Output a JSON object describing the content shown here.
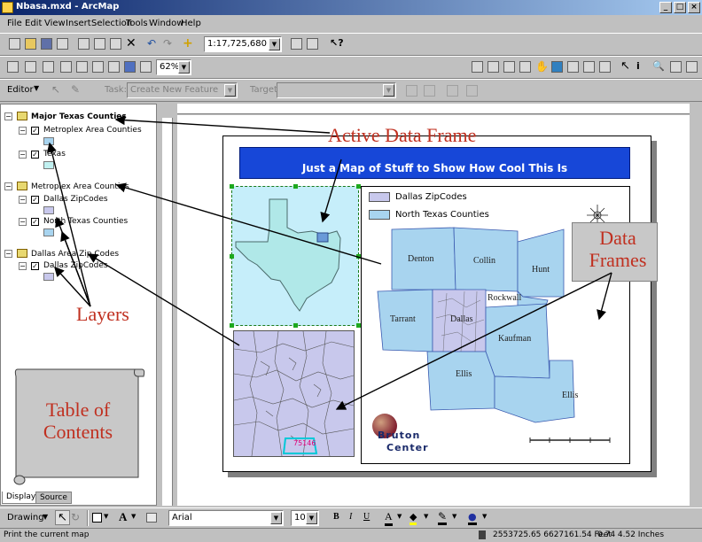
{
  "window": {
    "title": "Nbasa.mxd - ArcMap",
    "minimize": "_",
    "maximize": "□",
    "close": "×"
  },
  "menu": [
    "File",
    "Edit",
    "View",
    "Insert",
    "Selection",
    "Tools",
    "Window",
    "Help"
  ],
  "toolbar": {
    "scale_value": "1:17,725,680",
    "zoom_value": "62%"
  },
  "editor": {
    "editor_label": "Editor",
    "task_label": "Task:",
    "task_value": "Create New Feature",
    "target_label": "Target:",
    "target_value": ""
  },
  "toc": {
    "groups": [
      {
        "name": "Major Texas Counties",
        "layers": [
          {
            "name": "Metroplex Area Counties",
            "color": "#a8d4ef"
          },
          {
            "name": "Texas",
            "color": "#c0f0f0"
          }
        ]
      },
      {
        "name": "Metroplex Area Counties",
        "layers": [
          {
            "name": "Dallas ZipCodes",
            "color": "#c8c8ec"
          },
          {
            "name": "North Texas Counties",
            "color": "#a8d4ef"
          }
        ]
      },
      {
        "name": "Dallas Area Zip Codes",
        "layers": [
          {
            "name": "Dallas ZipCodes",
            "color": "#c8c8ec"
          }
        ]
      }
    ],
    "tabs": [
      "Display",
      "Source"
    ]
  },
  "map": {
    "title": "Just a Map of Stuff to Show How Cool This Is",
    "legend": [
      {
        "label": "Dallas ZipCodes",
        "color": "#c8c8ec"
      },
      {
        "label": "North Texas Counties",
        "color": "#a8d4ef"
      }
    ],
    "counties": [
      "Denton",
      "Collin",
      "Hunt",
      "Rockwall",
      "Tarrant",
      "Dallas",
      "Kaufman",
      "Ellis",
      "Ellis"
    ],
    "zip_label": "75146",
    "logo_line1": "Bruton",
    "logo_line2": "Center"
  },
  "annotations": {
    "active_data_frame": "Active Data Frame",
    "data_frames": "Data Frames",
    "layers": "Layers",
    "table_of_contents": "Table of Contents"
  },
  "drawing": {
    "drawing_label": "Drawing",
    "font_value": "Arial",
    "size_value": "10"
  },
  "status": {
    "message": "Print the current map",
    "coords": "2553725.65 6627161.54 Feet",
    "page_coords": "0.74 4.52 Inches"
  },
  "colors": {
    "titlebar": "#0a246a",
    "annotation": "#c03020",
    "banner": "#1747d8"
  }
}
